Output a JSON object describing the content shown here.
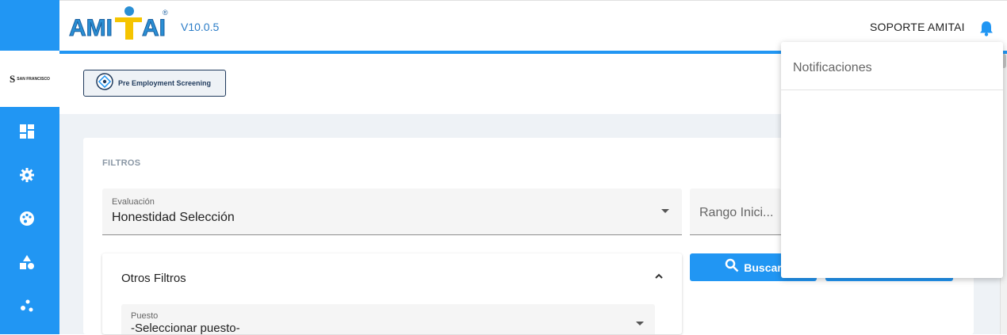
{
  "header": {
    "logo_text": "AMITAI",
    "version": "V10.0.5",
    "user_label": "SOPORTE AMITAI"
  },
  "company": {
    "logo_text": "SAN FRANCISCO"
  },
  "nav": {
    "items": [
      {
        "icon": "dashboard-icon"
      },
      {
        "icon": "gear-icon"
      },
      {
        "icon": "palette-icon"
      },
      {
        "icon": "shapes-icon"
      },
      {
        "icon": "bubble-chart-icon"
      }
    ]
  },
  "toolbar": {
    "pes_label": "Pre Employment Screening"
  },
  "filters": {
    "title": "FILTROS",
    "evaluation": {
      "label": "Evaluación",
      "value": "Honestidad Selección"
    },
    "range": {
      "placeholder": "Rango Inici..."
    },
    "other": {
      "title": "Otros Filtros",
      "position": {
        "label": "Puesto",
        "value": "-Seleccionar puesto-"
      }
    },
    "search_label": "Buscar"
  },
  "notifications": {
    "title": "Notificaciones"
  },
  "colors": {
    "accent": "#2196f3",
    "version_text": "#2a7cc7"
  }
}
